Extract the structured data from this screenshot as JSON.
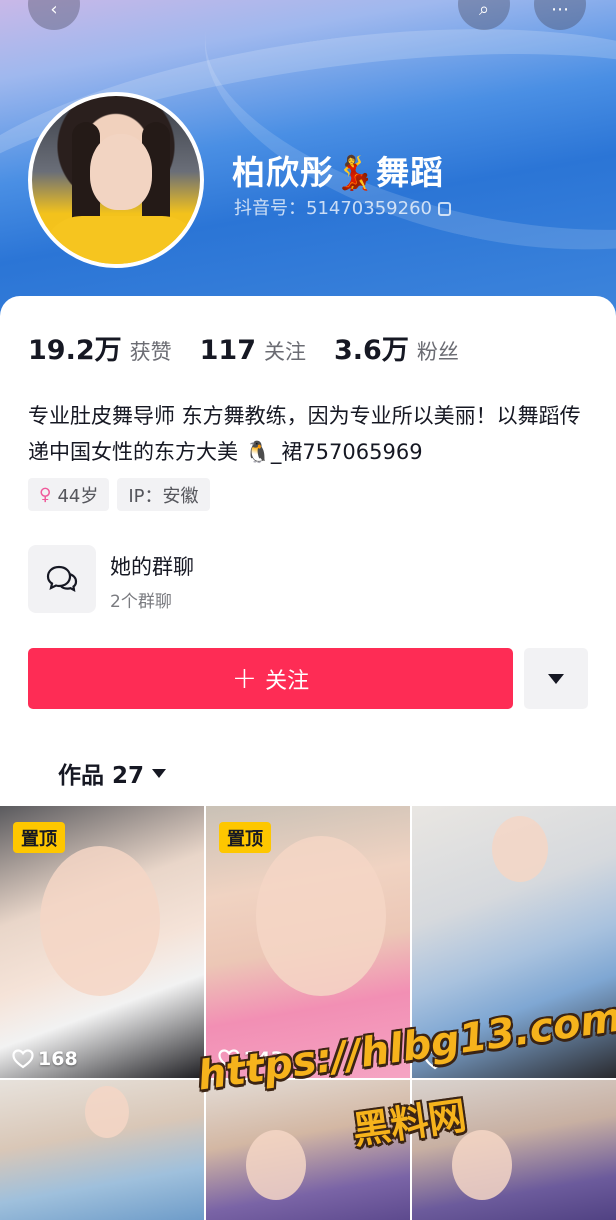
{
  "profile": {
    "name": "柏欣彤💃舞蹈",
    "douyin_id": "抖音号：51470359260",
    "avatar_icon": "avatar-photo"
  },
  "stats": [
    {
      "value": "19.2万",
      "label": "获赞"
    },
    {
      "value": "117",
      "label": "关注"
    },
    {
      "value": "3.6万",
      "label": "粉丝"
    }
  ],
  "bio": "专业肚皮舞导师 东方舞教练，因为专业所以美丽！以舞蹈传递中国女性的东方大美 🐧_裙757065969",
  "tags": {
    "gender_icon": "female-icon",
    "age": "44岁",
    "ip": "IP：安徽"
  },
  "group_chat": {
    "title": "她的群聊",
    "subtitle": "2个群聊",
    "icon": "chat-bubbles-icon"
  },
  "actions": {
    "follow_plus": "+",
    "follow_label": "关注",
    "more_icon": "triangle-down-icon"
  },
  "works_tab": {
    "label": "作品 27"
  },
  "videos": [
    {
      "pinned": "置顶",
      "likes": "168"
    },
    {
      "pinned": "置顶",
      "likes": "243"
    },
    {
      "likes": ""
    }
  ],
  "watermark": {
    "url": "https://hlbg13.com",
    "name": "黑料网"
  },
  "colors": {
    "follow_button": "#fe2c55",
    "pin_badge": "#fec700",
    "header_blue": "#2b75d6"
  }
}
